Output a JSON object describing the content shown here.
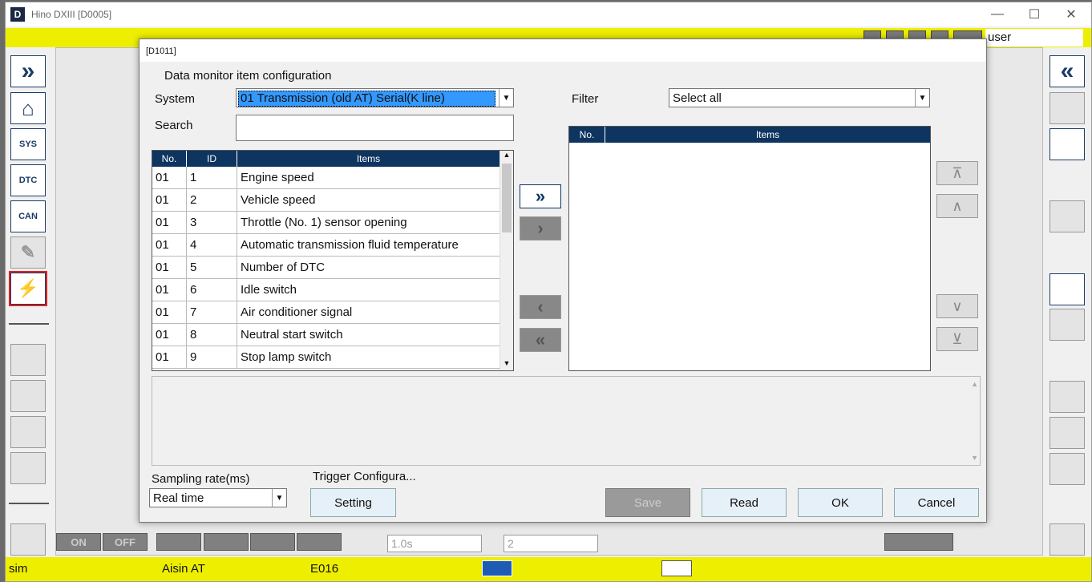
{
  "window": {
    "app_letter": "D",
    "title": "Hino DXIII [D0005]",
    "minimize": "—",
    "maximize": "☐",
    "close": "✕"
  },
  "topbar": {
    "user": "user"
  },
  "left_sidebar": {
    "collapse": "»",
    "home": "⌂",
    "sys": "SYS",
    "dtc": "DTC",
    "can": "CAN",
    "tools": "✎",
    "monitor": "⚡"
  },
  "right_sidebar": {
    "collapse": "«"
  },
  "dialog": {
    "id": "[D1011]",
    "heading": "Data monitor item configuration",
    "system_label": "System",
    "system_value": "01  Transmission (old AT)  Serial(K line)",
    "search_label": "Search",
    "search_value": "",
    "filter_label": "Filter",
    "filter_value": "Select all",
    "left_columns": [
      "No.",
      "ID",
      "Items"
    ],
    "left_rows": [
      {
        "no": "01",
        "id": "1",
        "item": "Engine speed"
      },
      {
        "no": "01",
        "id": "2",
        "item": "Vehicle speed"
      },
      {
        "no": "01",
        "id": "3",
        "item": "Throttle (No. 1) sensor opening"
      },
      {
        "no": "01",
        "id": "4",
        "item": "Automatic transmission fluid temperature"
      },
      {
        "no": "01",
        "id": "5",
        "item": "Number of DTC"
      },
      {
        "no": "01",
        "id": "6",
        "item": "Idle switch"
      },
      {
        "no": "01",
        "id": "7",
        "item": "Air conditioner signal"
      },
      {
        "no": "01",
        "id": "8",
        "item": "Neutral start switch"
      },
      {
        "no": "01",
        "id": "9",
        "item": "Stop lamp switch"
      }
    ],
    "right_columns": [
      "No.",
      "Items"
    ],
    "sampling_label": "Sampling rate(ms)",
    "sampling_value": "Real time",
    "trigger_label": "Trigger Configura...",
    "setting_button": "Setting",
    "save_button": "Save",
    "read_button": "Read",
    "ok_button": "OK",
    "cancel_button": "Cancel"
  },
  "strip": {
    "on": "ON",
    "off": "OFF",
    "interval": "1.0s",
    "count": "2"
  },
  "statusbar": {
    "mode": "sim",
    "system": "Aisin AT",
    "code": "E016"
  }
}
